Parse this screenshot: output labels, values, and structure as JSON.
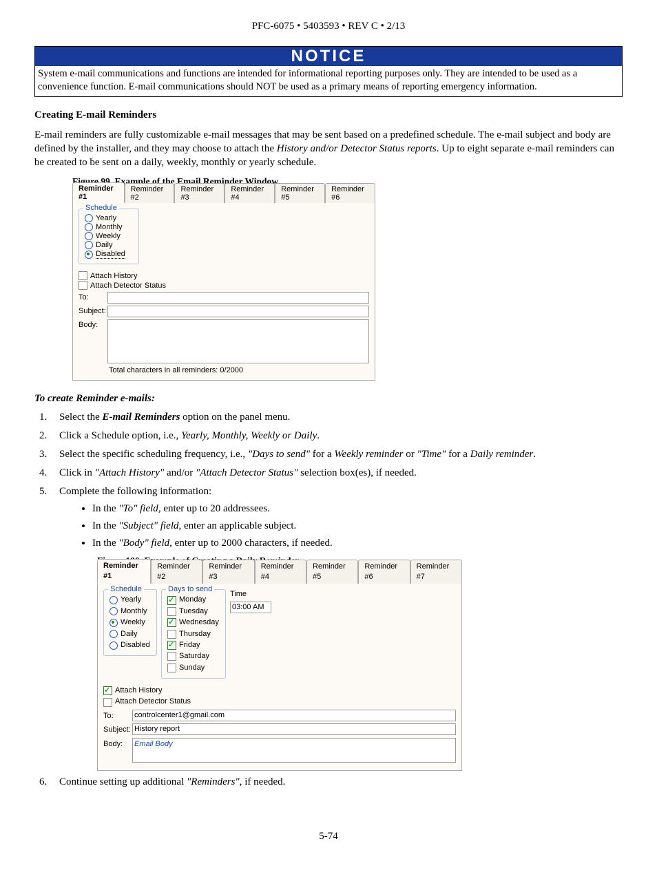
{
  "header": "PFC-6075 • 5403593 • REV C • 2/13",
  "notice": {
    "title": "NOTICE",
    "body": "System e-mail communications and functions are intended for informational reporting purposes only.  They are intended to be used as a convenience function. E-mail communications should NOT be used as a primary means of reporting emergency information."
  },
  "s1_title": "Creating E-mail Reminders",
  "s1_para_a": "E-mail reminders are fully customizable e-mail messages that may be sent based on a predefined schedule. The e-mail subject and body are defined by the installer, and they may choose to attach the ",
  "s1_para_b": "History and/or Detector Status reports",
  "s1_para_c": ". Up to eight separate e-mail reminders can be created to be sent on a daily, weekly, monthly or yearly schedule.",
  "fig99_caption": "Figure 99. Example of the Email Reminder Window",
  "fig99": {
    "tabs": [
      "Reminder #1",
      "Reminder #2",
      "Reminder #3",
      "Reminder #4",
      "Reminder #5",
      "Reminder #6"
    ],
    "schedule_title": "Schedule",
    "opt_yearly": "Yearly",
    "opt_monthly": "Monthly",
    "opt_weekly": "Weekly",
    "opt_daily": "Daily",
    "opt_disabled": "Disabled",
    "chk_history": "Attach History",
    "chk_detector": "Attach Detector Status",
    "lbl_to": "To:",
    "lbl_subject": "Subject:",
    "lbl_body": "Body:",
    "counter": "Total characters in all reminders: 0/2000"
  },
  "subhead": "To create Reminder e-mails:",
  "steps": {
    "s1a": "Select the ",
    "s1b": "E-mail Reminders",
    "s1c": " option on the panel menu.",
    "s2a": "Click a Schedule option, i.e., ",
    "s2b": "Yearly, Monthly, Weekly or Daily",
    "s2c": ".",
    "s3a": "Select the specific scheduling frequency, i.e., ",
    "s3b": "\"Days to send\"",
    "s3c": " for a ",
    "s3d": "Weekly reminder",
    "s3e": " or ",
    "s3f": "\"Time\"",
    "s3g": " for a ",
    "s3h": "Daily reminder",
    "s3i": ".",
    "s4a": "Click in ",
    "s4b": "\"Attach History\"",
    "s4c": " and/or ",
    "s4d": "\"Attach Detector Status\"",
    "s4e": " selection box(es), if needed.",
    "s5": "Complete the following information:",
    "s5_b1a": "In the ",
    "s5_b1b": "\"To\" field",
    "s5_b1c": ", enter up to 20 addressees.",
    "s5_b2a": "In the ",
    "s5_b2b": "\"Subject\" field",
    "s5_b2c": ", enter an applicable subject.",
    "s5_b3a": "In the ",
    "s5_b3b": "\"Body\" field",
    "s5_b3c": ", enter up to 2000 characters, if needed.",
    "s6a": "Continue setting up additional ",
    "s6b": "\"Reminders\"",
    "s6c": ", if needed."
  },
  "fig100_caption": "Figure 100. Example of Creating a Daily Reminder",
  "fig100": {
    "tabs": [
      "Reminder #1",
      "Reminder #2",
      "Reminder #3",
      "Reminder #4",
      "Reminder #5",
      "Reminder #6",
      "Reminder #7"
    ],
    "schedule_title": "Schedule",
    "opt_yearly": "Yearly",
    "opt_monthly": "Monthly",
    "opt_weekly": "Weekly",
    "opt_daily": "Daily",
    "opt_disabled": "Disabled",
    "days_title": "Days to send",
    "d_mon": "Monday",
    "d_tue": "Tuesday",
    "d_wed": "Wednesday",
    "d_thu": "Thursday",
    "d_fri": "Friday",
    "d_sat": "Saturday",
    "d_sun": "Sunday",
    "time_lbl": "Time",
    "time_val": "03:00 AM",
    "chk_history": "Attach History",
    "chk_detector": "Attach Detector Status",
    "lbl_to": "To:",
    "val_to": "controlcenter1@gmail.com",
    "lbl_subject": "Subject:",
    "val_subject": "History report",
    "lbl_body": "Body:",
    "val_body": "Email Body"
  },
  "page_num": "5-74"
}
